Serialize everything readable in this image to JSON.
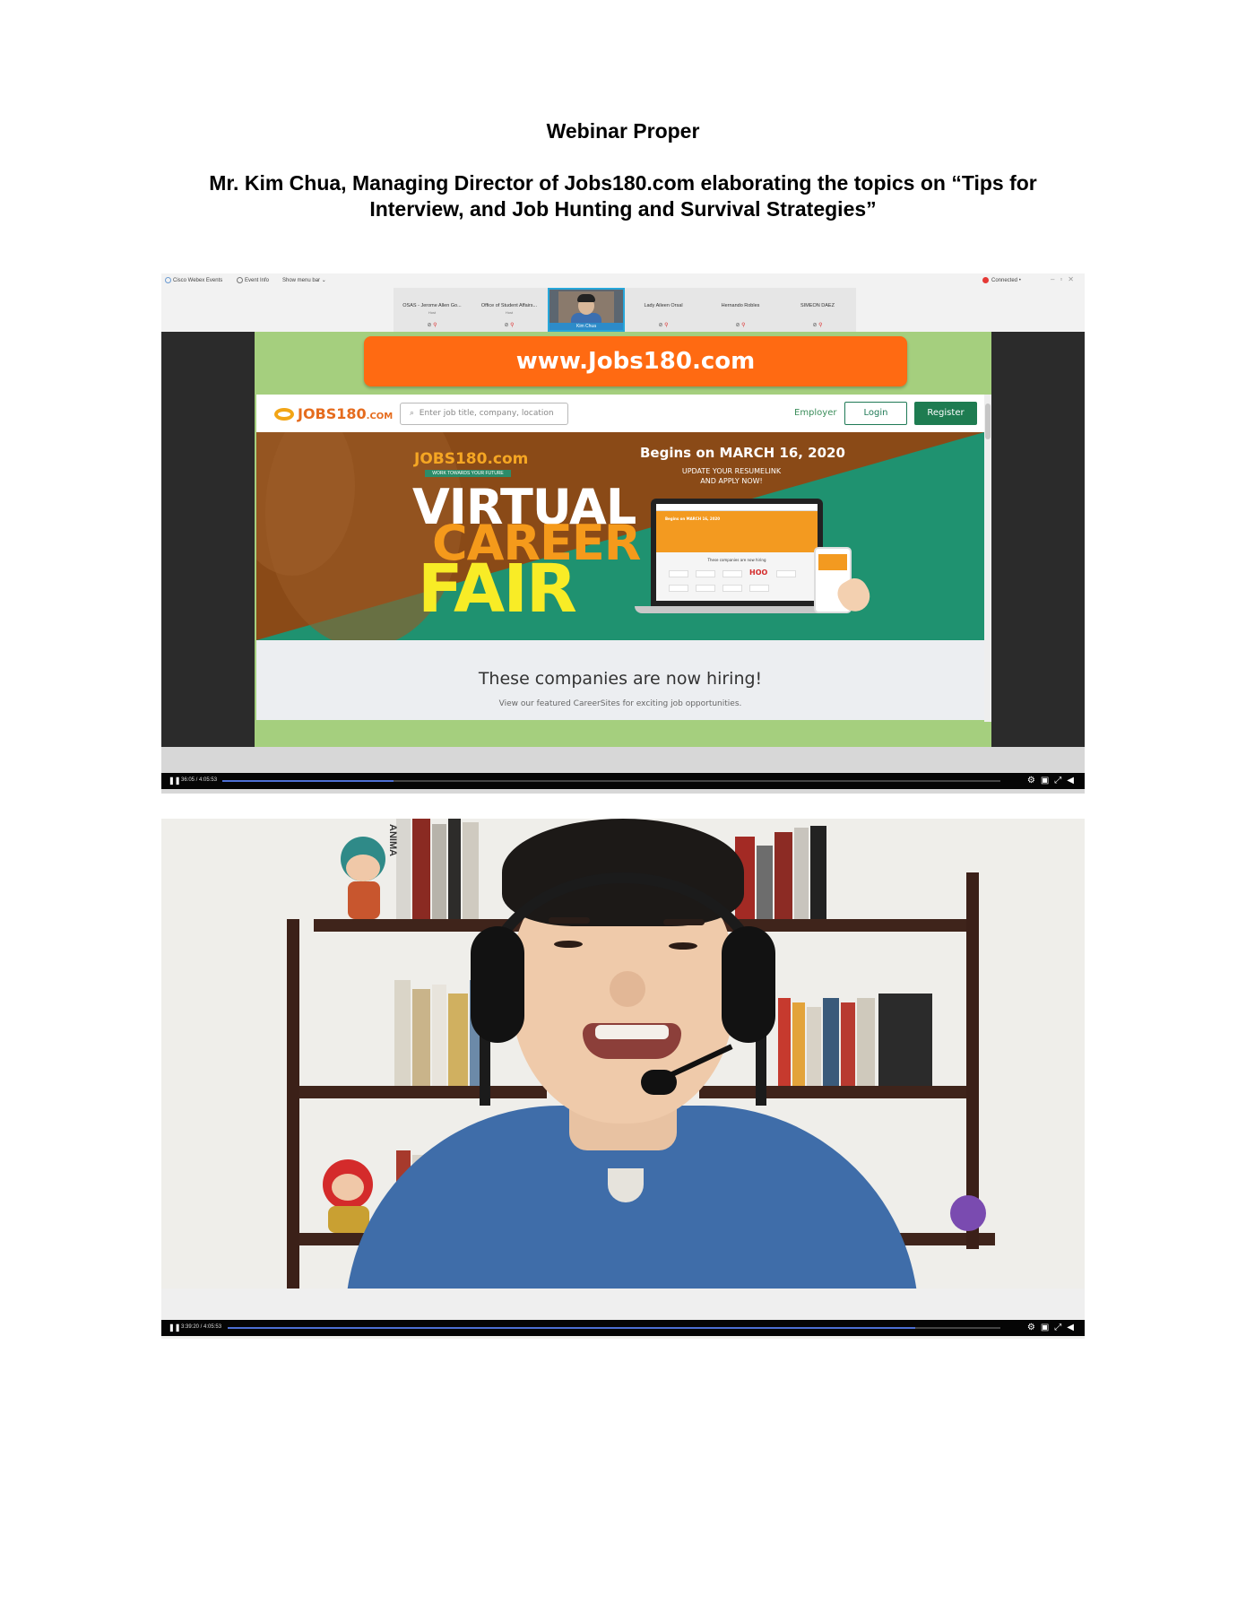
{
  "document": {
    "title": "Webinar Proper",
    "caption_line1": "Mr. Kim Chua, Managing Director of Jobs180.com elaborating the topics on “Tips for",
    "caption_line2": "Interview, and Job Hunting  and Survival Strategies”"
  },
  "screenshot1": {
    "webex": {
      "app_name": "Cisco Webex Events",
      "event_info": "Event Info",
      "show_menu": "Show menu bar ⌄",
      "connection_status": "Connected •",
      "participants": [
        {
          "name": "OSAS - Jerome Allen Go...",
          "sub": "Host"
        },
        {
          "name": "Office of Student Affairs...",
          "sub": "Host"
        },
        {
          "name": "Kim Chua",
          "sub": ""
        },
        {
          "name": "Lady Aileen Orsal",
          "sub": ""
        },
        {
          "name": "Hernando Robles",
          "sub": ""
        },
        {
          "name": "SIMEON DAEZ",
          "sub": ""
        }
      ]
    },
    "site": {
      "url_banner": "www.Jobs180.com",
      "logo": "JOBS180",
      "logo_suffix": ".COM",
      "search_placeholder": "Enter job title, company, location",
      "employer_link": "Employer",
      "login_button": "Login",
      "register_button": "Register",
      "hero": {
        "mini_logo": "JOBS180.com",
        "mini_tagline": "WORK TOWARDS YOUR FUTURE",
        "line1": "VIRTUAL",
        "line2": "CAREER",
        "line3": "FAIR",
        "begins": "Begins on MARCH 16, 2020",
        "update": "UPDATE YOUR RESUMELINK",
        "apply": "AND APPLY NOW!",
        "laptop_heading": "These companies are now hiring",
        "laptop_brand": "HOO"
      },
      "companies_title": "These companies are now hiring!",
      "companies_sub": "View our featured CareerSites for exciting job opportunities."
    },
    "player": {
      "time": "36:05 / 4:05:53",
      "progress": 0.22
    }
  },
  "screenshot2": {
    "player": {
      "time": "3:39:20 / 4:05:53",
      "progress": 0.89
    },
    "book_spine_text": "ANIMA"
  },
  "icons": {
    "pause": "pause-icon",
    "settings": "gear-icon",
    "pip": "picture-in-picture-icon",
    "fullscreen": "fullscreen-icon",
    "volume": "volume-icon"
  },
  "colors": {
    "banner_orange": "#ff6a12",
    "site_green": "#1e7c51",
    "frame_green": "#a5cf7e",
    "progress_blue": "#4d6fd4"
  }
}
